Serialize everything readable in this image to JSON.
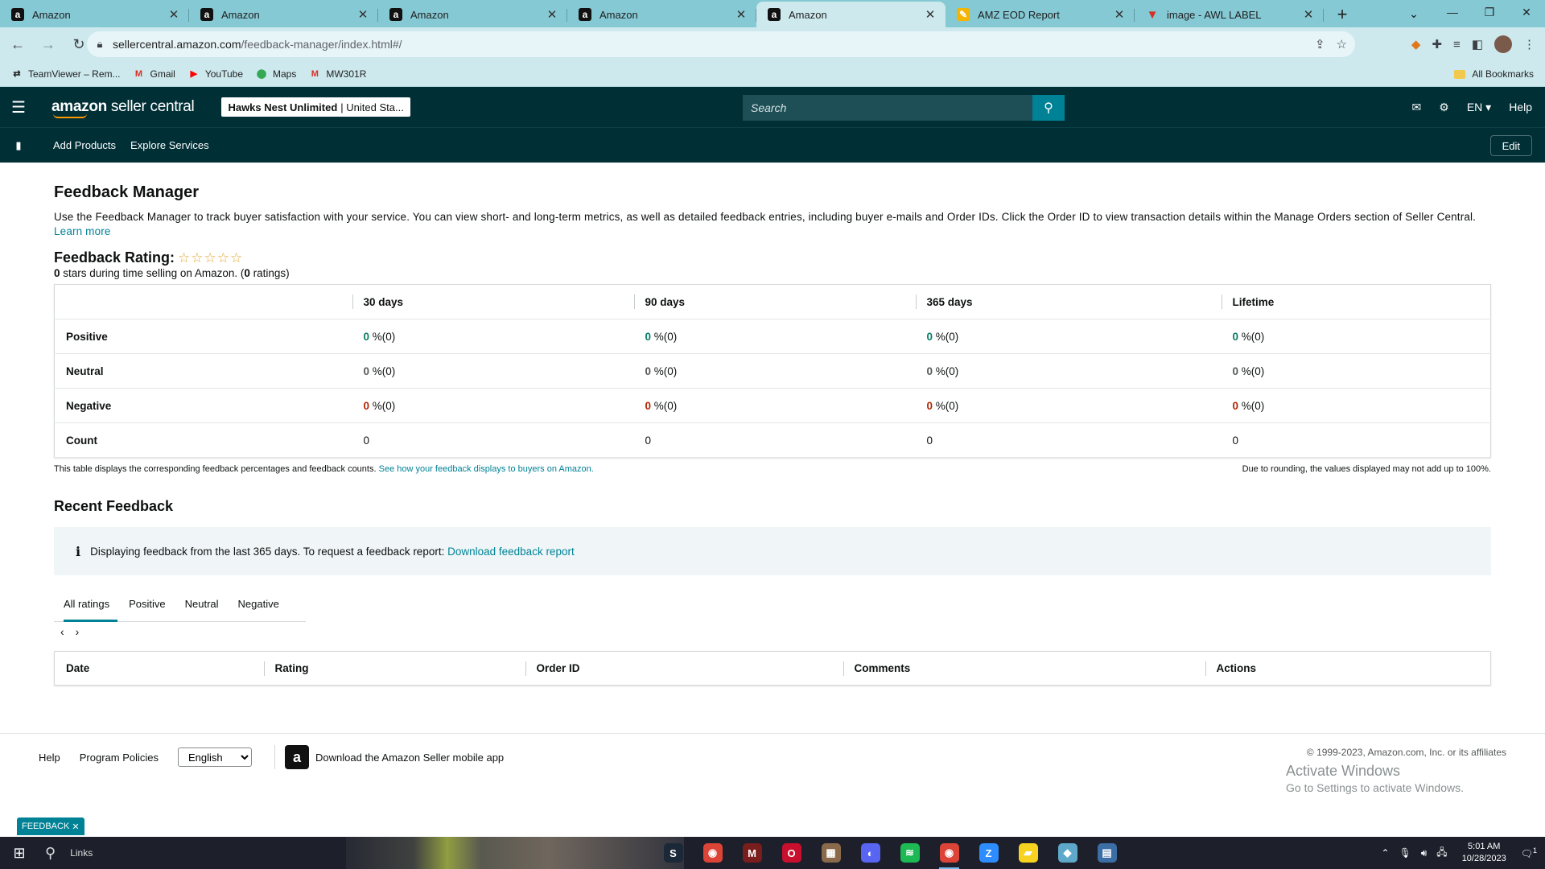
{
  "browser": {
    "tabs": [
      {
        "title": "Amazon",
        "favicon": "a",
        "type": "amazon",
        "active": false
      },
      {
        "title": "Amazon",
        "favicon": "a",
        "type": "amazon",
        "active": false
      },
      {
        "title": "Amazon",
        "favicon": "a",
        "type": "amazon",
        "active": false
      },
      {
        "title": "Amazon",
        "favicon": "a",
        "type": "amazon",
        "active": false
      },
      {
        "title": "Amazon",
        "favicon": "a",
        "type": "amazon",
        "active": true
      },
      {
        "title": "AMZ EOD Report",
        "favicon": "✎",
        "type": "sheet",
        "active": false
      },
      {
        "title": "image - AWL LABEL",
        "favicon": "▼",
        "type": "wolf",
        "active": false
      }
    ],
    "url_host": "sellercentral.amazon.com",
    "url_path": "/feedback-manager/index.html#/",
    "bookmarks": [
      {
        "label": "TeamViewer – Rem...",
        "icon": "teamviewer-icon",
        "glyph": "⇄",
        "color": "#1f1f1f"
      },
      {
        "label": "Gmail",
        "icon": "gmail-icon",
        "glyph": "M",
        "color": "#d93025"
      },
      {
        "label": "YouTube",
        "icon": "youtube-icon",
        "glyph": "▶",
        "color": "#ff0000"
      },
      {
        "label": "Maps",
        "icon": "maps-icon",
        "glyph": "⬤",
        "color": "#34a853"
      },
      {
        "label": "MW301R",
        "icon": "mercusys-icon",
        "glyph": "M",
        "color": "#d93025"
      }
    ],
    "all_bookmarks": "All Bookmarks"
  },
  "header": {
    "logo_a": "amazon",
    "logo_b": " seller central",
    "store_name": "Hawks Nest Unlimited",
    "store_region": "| United Sta...",
    "search_placeholder": "Search",
    "language": "EN",
    "help": "Help"
  },
  "subnav": {
    "items": [
      "Add Products",
      "Explore Services"
    ],
    "edit": "Edit"
  },
  "page": {
    "title": "Feedback Manager",
    "intro": "Use the Feedback Manager to track buyer satisfaction with your service. You can view short- and long-term metrics, as well as detailed feedback entries, including buyer e-mails and Order IDs. Click the Order ID to view transaction details within the Manage Orders section of Seller Central.",
    "learn_more": "Learn more",
    "rating_label": "Feedback Rating:",
    "stars": "☆☆☆☆☆",
    "rating_stars_value": "0",
    "rating_text_mid": " stars during time selling on Amazon. (",
    "rating_count": "0",
    "rating_text_end": " ratings)"
  },
  "feedback_table": {
    "columns": [
      "30 days",
      "90 days",
      "365 days",
      "Lifetime"
    ],
    "rows": [
      {
        "label": "Positive",
        "kind": "pos",
        "cells": [
          {
            "v": "0",
            "s": " %(0)"
          },
          {
            "v": "0",
            "s": " %(0)"
          },
          {
            "v": "0",
            "s": " %(0)"
          },
          {
            "v": "0",
            "s": " %(0)"
          }
        ]
      },
      {
        "label": "Neutral",
        "kind": "neu",
        "cells": [
          {
            "v": "0",
            "s": " %(0)"
          },
          {
            "v": "0",
            "s": " %(0)"
          },
          {
            "v": "0",
            "s": " %(0)"
          },
          {
            "v": "0",
            "s": " %(0)"
          }
        ]
      },
      {
        "label": "Negative",
        "kind": "neg",
        "cells": [
          {
            "v": "0",
            "s": " %(0)"
          },
          {
            "v": "0",
            "s": " %(0)"
          },
          {
            "v": "0",
            "s": " %(0)"
          },
          {
            "v": "0",
            "s": " %(0)"
          }
        ]
      },
      {
        "label": "Count",
        "kind": "count",
        "cells": [
          {
            "v": "0",
            "s": ""
          },
          {
            "v": "0",
            "s": ""
          },
          {
            "v": "0",
            "s": ""
          },
          {
            "v": "0",
            "s": ""
          }
        ]
      }
    ],
    "note_left": "This table displays the corresponding feedback percentages and feedback counts.",
    "note_link": "See how your feedback displays to buyers on Amazon.",
    "note_right": "Due to rounding, the values displayed may not add up to 100%."
  },
  "recent": {
    "title": "Recent Feedback",
    "info_text": "Displaying feedback from the last 365 days. To request a feedback report:",
    "info_link": "Download feedback report",
    "tabs": [
      "All ratings",
      "Positive",
      "Neutral",
      "Negative"
    ],
    "active_tab": "All ratings",
    "columns": [
      "Date",
      "Rating",
      "Order ID",
      "Comments",
      "Actions"
    ]
  },
  "footer": {
    "help": "Help",
    "policies": "Program Policies",
    "language": "English",
    "app_promo": "Download the Amazon Seller mobile app",
    "copyright": "© 1999-2023, Amazon.com, Inc. or its affiliates",
    "activate_title": "Activate Windows",
    "activate_sub": "Go to Settings to activate Windows.",
    "feedback_tab": "FEEDBACK"
  },
  "taskbar": {
    "search_label": "Links",
    "apps": [
      {
        "name": "steam-icon",
        "glyph": "S",
        "color": "#1b2838",
        "active": false
      },
      {
        "name": "chrome-icon",
        "glyph": "◉",
        "color": "#db4437",
        "active": false
      },
      {
        "name": "app-m-icon",
        "glyph": "M",
        "color": "#7a1d1d",
        "active": false
      },
      {
        "name": "opera-icon",
        "glyph": "O",
        "color": "#c8102e",
        "active": false
      },
      {
        "name": "photo-app-icon",
        "glyph": "▦",
        "color": "#8a6a4a",
        "active": false
      },
      {
        "name": "discord-icon",
        "glyph": "◐",
        "color": "#5865f2",
        "active": false
      },
      {
        "name": "spotify-icon",
        "glyph": "≋",
        "color": "#1db954",
        "active": false
      },
      {
        "name": "chrome-profile-icon",
        "glyph": "◉",
        "color": "#db4437",
        "active": true
      },
      {
        "name": "zoom-icon",
        "glyph": "Z",
        "color": "#2d8cff",
        "active": false
      },
      {
        "name": "sticky-notes-icon",
        "glyph": "▰",
        "color": "#f7d21e",
        "active": false
      },
      {
        "name": "paint-app-icon",
        "glyph": "◆",
        "color": "#5ea9c9",
        "active": false
      },
      {
        "name": "calculator-icon",
        "glyph": "▤",
        "color": "#3a6ea5",
        "active": false
      }
    ],
    "time": "5:01 AM",
    "date": "10/28/2023",
    "notification_count": "1"
  }
}
